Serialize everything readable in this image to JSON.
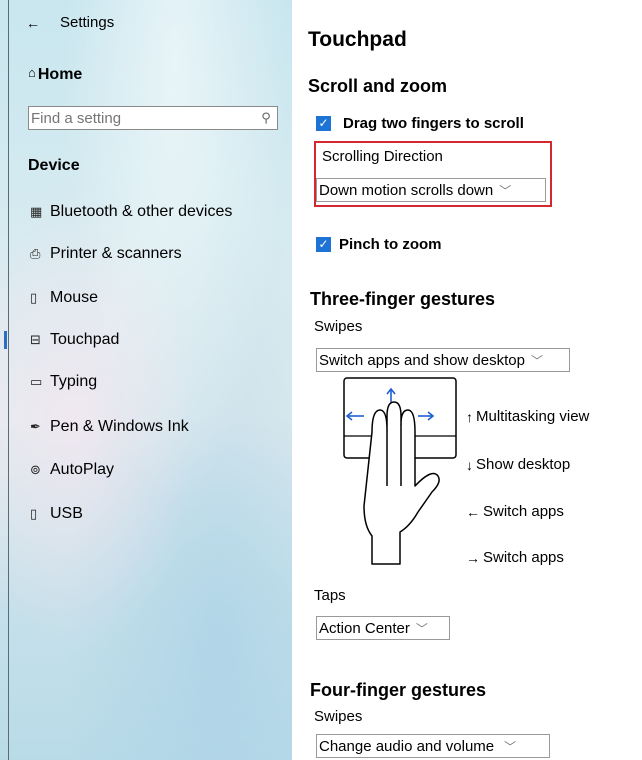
{
  "window": {
    "title": "Settings",
    "back_icon": "back-arrow-icon"
  },
  "sidebar": {
    "home_label": "Home",
    "search_placeholder": "Find a setting",
    "section_title": "Device",
    "items": [
      {
        "label": "Bluetooth & other devices",
        "icon": "bluetooth-icon"
      },
      {
        "label": "Printer & scanners",
        "icon": "printer-icon"
      },
      {
        "label": "Mouse",
        "icon": "mouse-icon"
      },
      {
        "label": "Touchpad",
        "icon": "touchpad-icon",
        "selected": true
      },
      {
        "label": "Typing",
        "icon": "keyboard-icon"
      },
      {
        "label": "Pen & Windows Ink",
        "icon": "pen-icon"
      },
      {
        "label": "AutoPlay",
        "icon": "autoplay-icon"
      },
      {
        "label": "USB",
        "icon": "usb-icon"
      }
    ]
  },
  "main": {
    "title": "Touchpad",
    "scroll_zoom": {
      "heading": "Scroll and zoom",
      "drag_two_fingers": {
        "label": "Drag two fingers to scroll",
        "checked": true
      },
      "scrolling_direction_label": "Scrolling Direction",
      "scrolling_direction_value": "Down motion scrolls down",
      "pinch_to_zoom": {
        "label": "Pinch to zoom",
        "checked": true
      }
    },
    "three_finger": {
      "heading": "Three-finger gestures",
      "swipes_label": "Swipes",
      "swipes_value": "Switch apps and show desktop",
      "gestures": [
        {
          "arrow": "↑",
          "label": "Multitasking view"
        },
        {
          "arrow": "↓",
          "label": "Show desktop"
        },
        {
          "arrow": "←",
          "label": "Switch apps"
        },
        {
          "arrow": "→",
          "label": "Switch apps"
        }
      ],
      "taps_label": "Taps",
      "taps_value": "Action Center"
    },
    "four_finger": {
      "heading": "Four-finger gestures",
      "swipes_label": "Swipes",
      "swipes_value": "Change audio and volume"
    }
  },
  "colors": {
    "accent": "#1d74d4",
    "highlight_border": "#d6262f",
    "nav_indicator": "#2b6cc4"
  }
}
